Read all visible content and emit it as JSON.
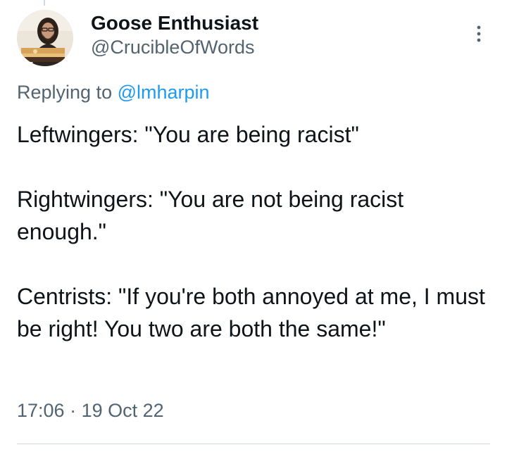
{
  "author": {
    "display_name": "Goose Enthusiast",
    "handle": "@CrucibleOfWords",
    "avatar_icon": "profile-photo"
  },
  "reply": {
    "prefix": "Replying to ",
    "mention": "@lmharpin"
  },
  "tweet": {
    "paragraphs": [
      "Leftwingers: \"You are being racist\"",
      "Rightwingers: \"You are not being racist enough.\"",
      "Centrists: \"If you're both annoyed at me, I must be right! You two are both the same!\""
    ]
  },
  "meta": {
    "time": "17:06",
    "separator": " · ",
    "date": "19 Oct 22"
  },
  "icons": {
    "more": "more-vertical-icon"
  },
  "colors": {
    "text_primary": "#0f1419",
    "text_secondary": "#536471",
    "link": "#1d9bf0",
    "divider": "#cfd9de"
  }
}
